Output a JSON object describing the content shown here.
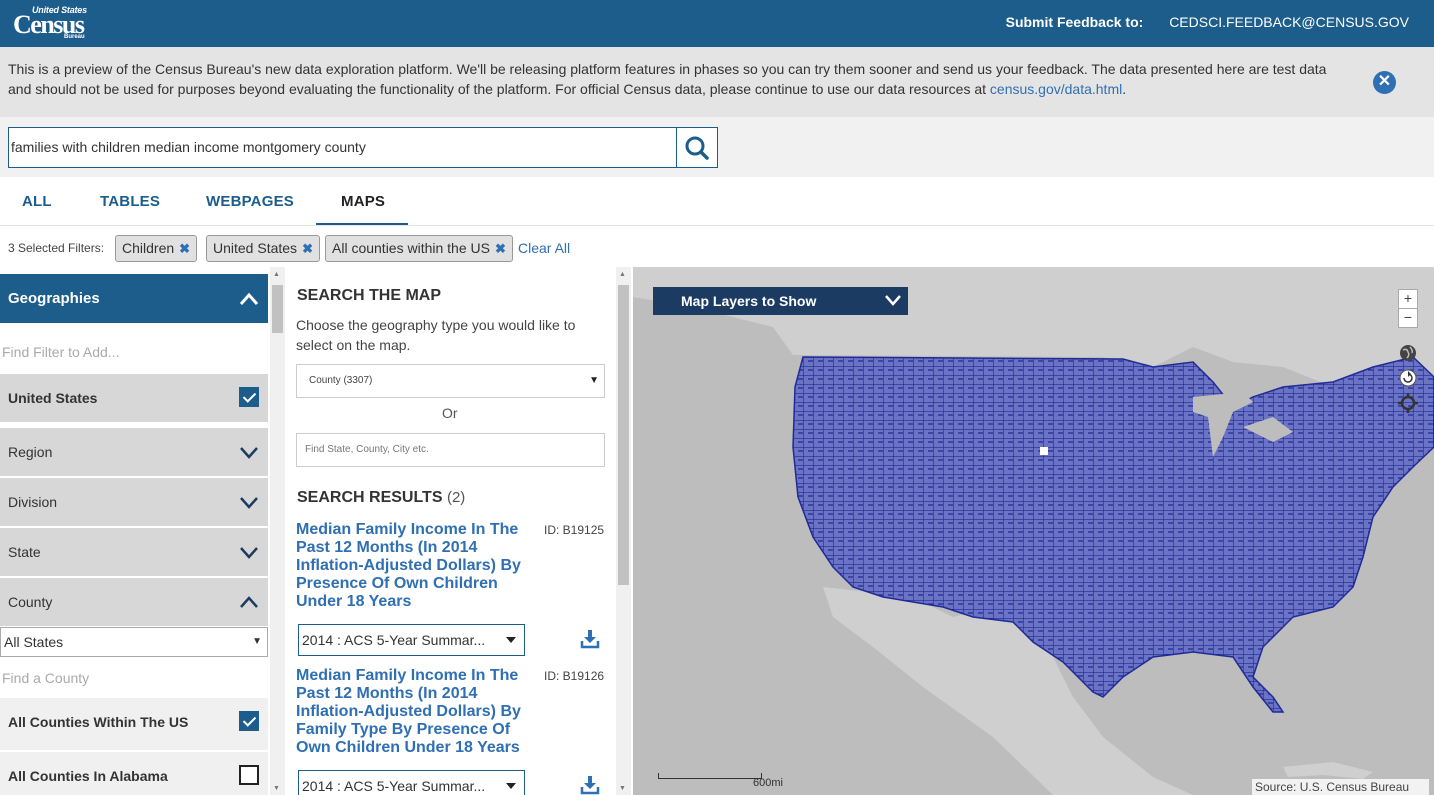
{
  "header": {
    "logo_line1": "United States",
    "logo_line2": "Census",
    "logo_line3": "Bureau",
    "feedback_label": "Submit Feedback to:",
    "feedback_email": "CEDSCI.FEEDBACK@CENSUS.GOV"
  },
  "banner": {
    "text": "This is a preview of the Census Bureau's new data exploration platform. We'll be releasing platform features in phases so you can try them sooner and send us your feedback. The data presented here are test data and should not be used for purposes beyond evaluating the functionality of the platform. For official Census data, please continue to use our data resources at ",
    "link_text": "census.gov/data.html",
    "text_end": ".",
    "close_glyph": "✕"
  },
  "search": {
    "value": "families with children median income montgomery county"
  },
  "tabs": [
    {
      "label": "ALL"
    },
    {
      "label": "TABLES"
    },
    {
      "label": "WEBPAGES"
    },
    {
      "label": "MAPS",
      "active": true
    }
  ],
  "filters": {
    "label": "3 Selected Filters:",
    "chips": [
      {
        "label": "Children"
      },
      {
        "label": "United States"
      },
      {
        "label": "All counties within the US"
      }
    ],
    "remove_glyph": "✖",
    "clear_all": "Clear All"
  },
  "sidebar": {
    "heading": "Geographies",
    "find_placeholder": "Find Filter to Add...",
    "rows": [
      {
        "label": "United States",
        "checked": true
      },
      {
        "label": "Region"
      },
      {
        "label": "Division"
      },
      {
        "label": "State"
      },
      {
        "label": "County",
        "expanded": true
      }
    ],
    "state_select": "All States",
    "find_county_placeholder": "Find a County",
    "county_options": [
      {
        "label": "All Counties Within The US",
        "checked": true
      },
      {
        "label": "All Counties In Alabama",
        "checked": false
      }
    ]
  },
  "middle": {
    "title": "SEARCH THE MAP",
    "description": "Choose the geography type you would like to select on the map.",
    "geo_select": "County (3307)",
    "or_text": "Or",
    "find_placeholder": "Find State, County, City etc.",
    "results_title": "SEARCH RESULTS",
    "results_count": "(2)",
    "results": [
      {
        "title": "Median Family Income In The Past 12 Months (In 2014 Inflation-Adjusted Dollars) By Presence Of Own Children Under 18 Years",
        "id": "ID: B19125",
        "dataset": "2014 : ACS 5-Year Summar..."
      },
      {
        "title": "Median Family Income In The Past 12 Months (In 2014 Inflation-Adjusted Dollars) By Family Type By Presence Of Own Children Under 18 Years",
        "id": "ID: B19126",
        "dataset": "2014 : ACS 5-Year Summar..."
      }
    ]
  },
  "map": {
    "layers_label": "Map Layers to Show",
    "zoom_in": "+",
    "zoom_out": "−",
    "scale_label": "600mi",
    "source": "Source: U.S. Census Bureau",
    "colors": {
      "land": "#cfcfcf",
      "water": "#bdbdbd",
      "counties_fill": "#6b73c4",
      "counties_border": "#1f2b96"
    }
  }
}
